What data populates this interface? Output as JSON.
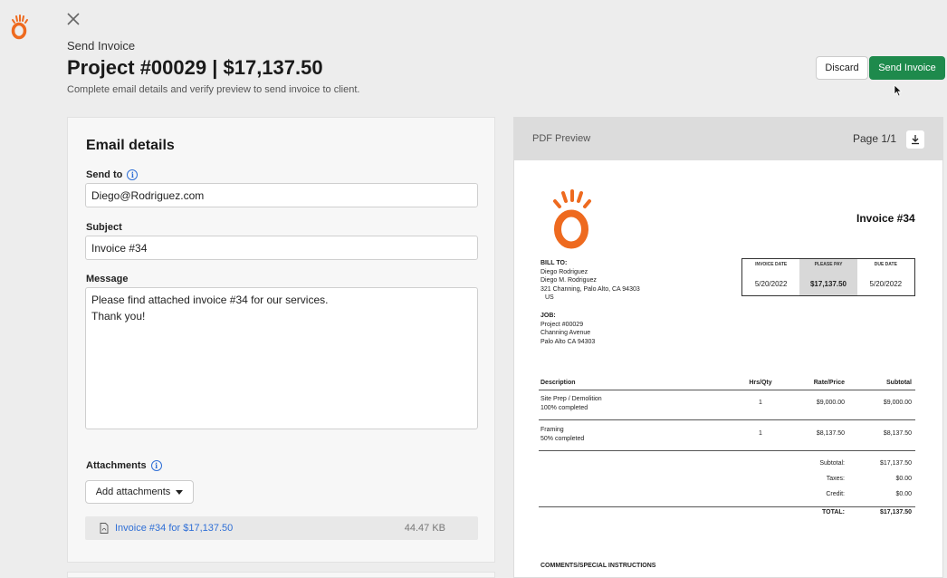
{
  "header": {
    "eyebrow": "Send Invoice",
    "title": "Project #00029 | $17,137.50",
    "subtitle": "Complete email details and verify preview to send invoice to client.",
    "discard_label": "Discard",
    "send_label": "Send Invoice"
  },
  "email": {
    "card_title": "Email details",
    "send_to_label": "Send to",
    "send_to_value": "Diego@Rodriguez.com",
    "subject_label": "Subject",
    "subject_value": "Invoice #34",
    "message_label": "Message",
    "message_line1": "Please find attached invoice #34 for our services.",
    "message_line2": "Thank you!",
    "attachments_label": "Attachments",
    "add_attachments_label": "Add attachments",
    "attachment_name": "Invoice #34 for $17,137.50",
    "attachment_size": "44.47 KB"
  },
  "preview": {
    "label": "PDF Preview",
    "page": "Page 1/1",
    "invoice_title": "Invoice #34",
    "bill_to_label": "BILL TO:",
    "bill_to_lines": [
      "Diego Rodriguez",
      "Diego M. Rodriguez",
      "321 Channing, Palo Alto, CA 94303",
      "US"
    ],
    "job_label": "JOB:",
    "job_lines": [
      "Project #00029",
      "Channing Avenue",
      "Palo Alto CA 94303"
    ],
    "dates": [
      {
        "header": "INVOICE DATE",
        "value": "5/20/2022"
      },
      {
        "header": "PLEASE PAY",
        "value": "$17,137.50"
      },
      {
        "header": "DUE DATE",
        "value": "5/20/2022"
      }
    ],
    "table_headers": {
      "desc": "Description",
      "qty": "Hrs/Qty",
      "rate": "Rate/Price",
      "sub": "Subtotal"
    },
    "rows": [
      {
        "desc": "Site Prep / Demolition",
        "note": "100% completed",
        "qty": "1",
        "rate": "$9,000.00",
        "sub": "$9,000.00"
      },
      {
        "desc": "Framing",
        "note": "50% completed",
        "qty": "1",
        "rate": "$8,137.50",
        "sub": "$8,137.50"
      }
    ],
    "totals": [
      {
        "label": "Subtotal:",
        "value": "$17,137.50"
      },
      {
        "label": "Taxes:",
        "value": "$0.00"
      },
      {
        "label": "Credit:",
        "value": "$0.00"
      },
      {
        "label": "TOTAL:",
        "value": "$17,137.50"
      }
    ],
    "comments_label": "COMMENTS/SPECIAL INSTRUCTIONS"
  },
  "colors": {
    "accent": "#1e8a4c",
    "brand": "#ee6a1f",
    "link": "#2f6fd6"
  },
  "icons": [
    "close-icon",
    "info-icon",
    "pdf-file-icon",
    "download-icon",
    "chevron-down-icon",
    "mouse-cursor-icon"
  ]
}
